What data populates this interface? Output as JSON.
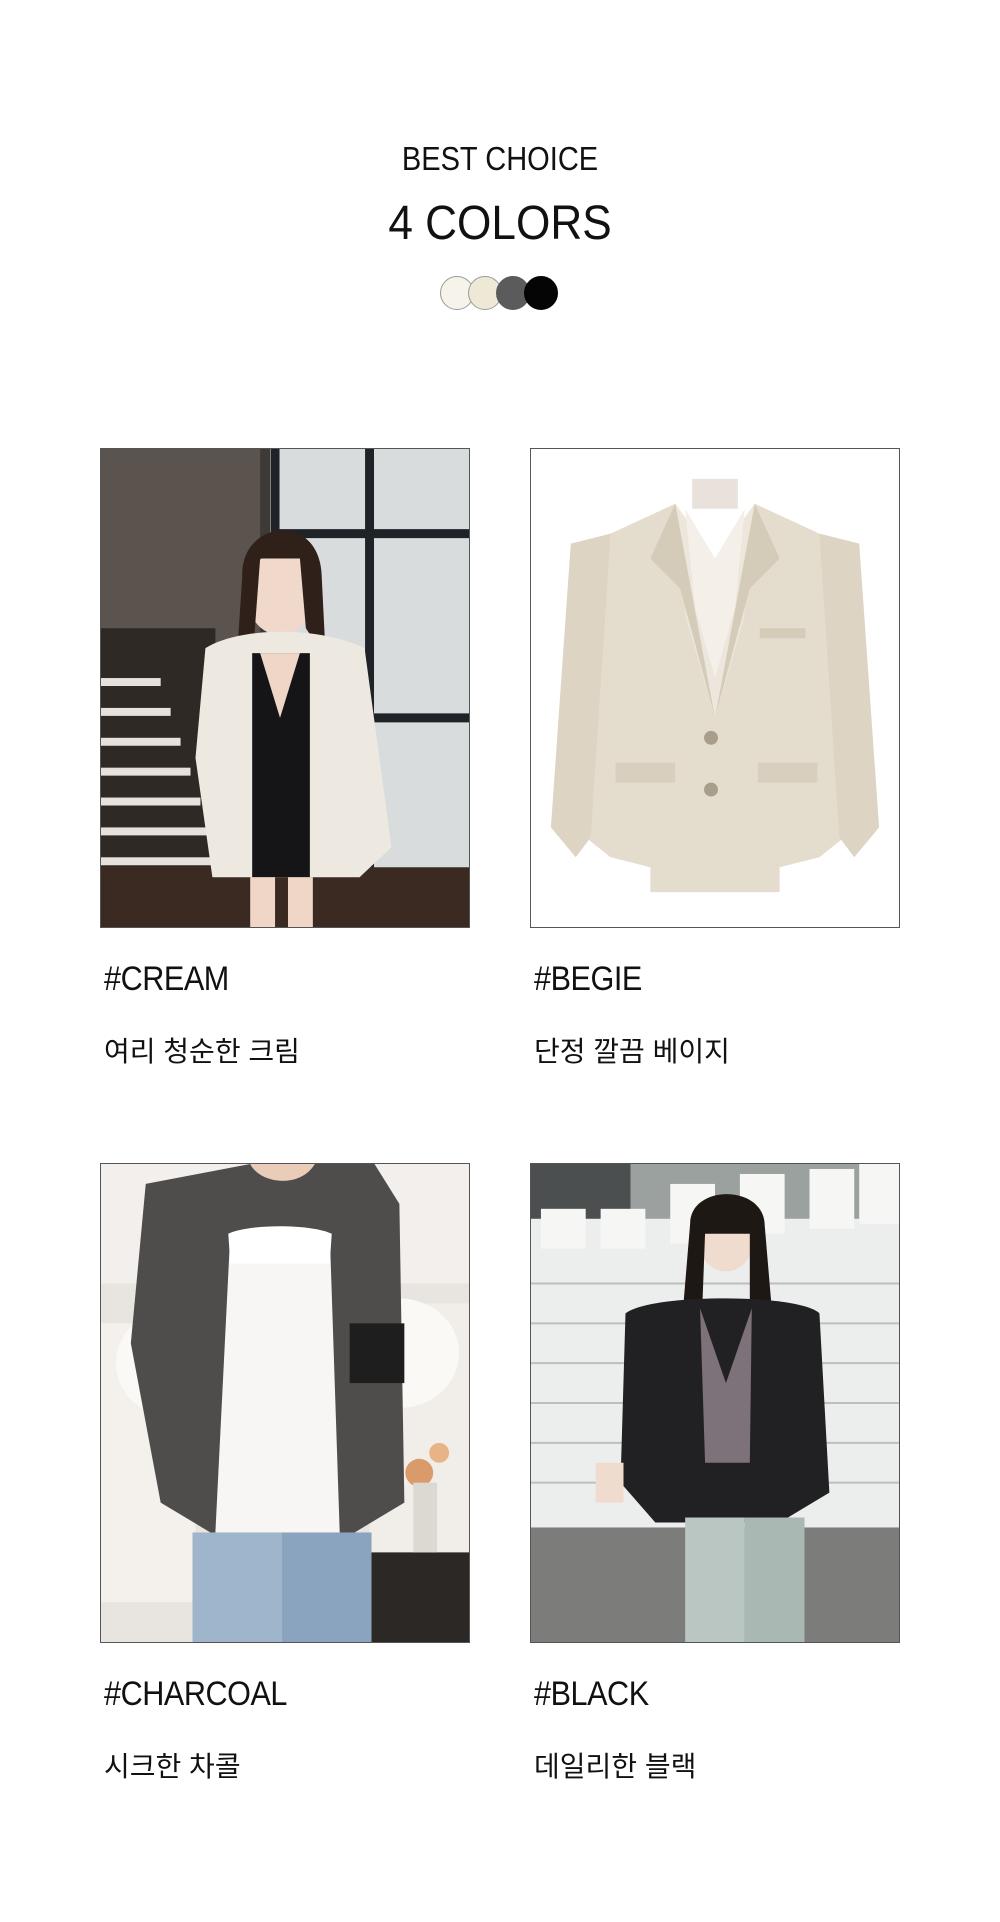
{
  "header": {
    "eyebrow": "BEST CHOICE",
    "title": "4 COLORS"
  },
  "swatches": [
    {
      "name": "cream",
      "color": "#f5f3ea"
    },
    {
      "name": "beige",
      "color": "#eee9d7"
    },
    {
      "name": "charcoal",
      "color": "#5b5b5b"
    },
    {
      "name": "black",
      "color": "#050505"
    }
  ],
  "products": [
    {
      "tag": "#CREAM",
      "description": "여리 청순한 크림",
      "image": "model-cream-blazer-photo"
    },
    {
      "tag": "#BEGIE",
      "description": "단정 깔끔 베이지",
      "image": "beige-blazer-mannequin-photo"
    },
    {
      "tag": "#CHARCOAL",
      "description": "시크한 차콜",
      "image": "model-charcoal-blazer-photo"
    },
    {
      "tag": "#BLACK",
      "description": "데일리한 블랙",
      "image": "model-black-blazer-photo"
    }
  ]
}
